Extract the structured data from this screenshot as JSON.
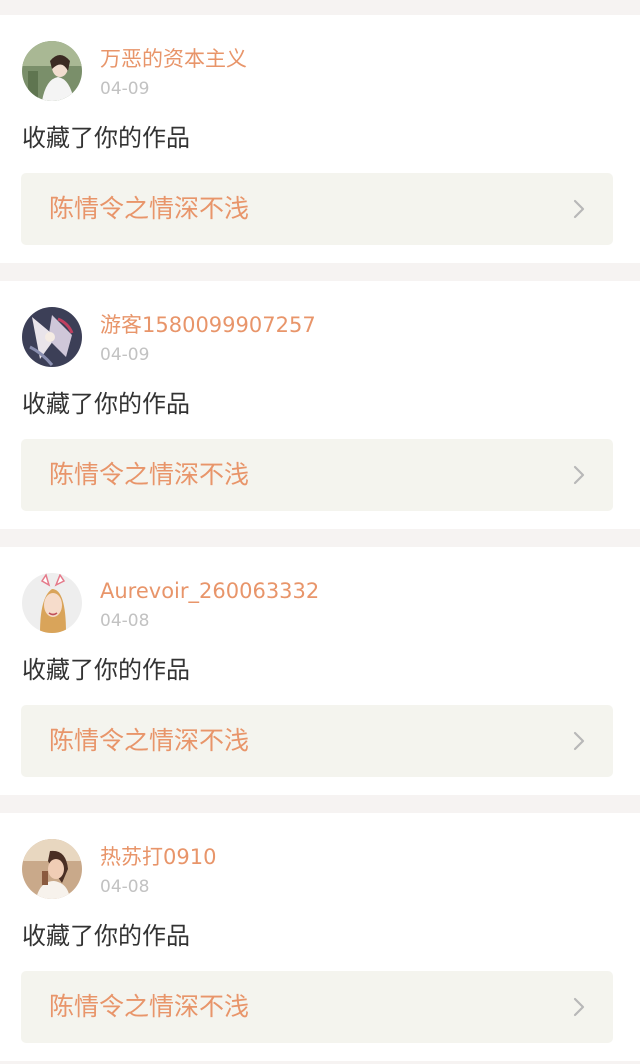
{
  "colors": {
    "accent": "#e8956a",
    "date": "#c2c2c2",
    "text": "#333333",
    "link_bg": "#f4f4ee",
    "page_bg": "#f6f3f2"
  },
  "notifications": [
    {
      "username": "万恶的资本主义",
      "date": "04-09",
      "action": "收藏了你的作品",
      "work_title": "陈情令之情深不浅",
      "avatar_icon": "avatar-girl-portrait-icon"
    },
    {
      "username": "游客1580099907257",
      "date": "04-09",
      "action": "收藏了你的作品",
      "work_title": "陈情令之情深不浅",
      "avatar_icon": "avatar-illustration-icon"
    },
    {
      "username": "Aurevoir_260063332",
      "date": "04-08",
      "action": "收藏了你的作品",
      "work_title": "陈情令之情深不浅",
      "avatar_icon": "avatar-girl-ears-icon"
    },
    {
      "username": "热苏打0910",
      "date": "04-08",
      "action": "收藏了你的作品",
      "work_title": "陈情令之情深不浅",
      "avatar_icon": "avatar-girl-outdoor-icon"
    }
  ]
}
